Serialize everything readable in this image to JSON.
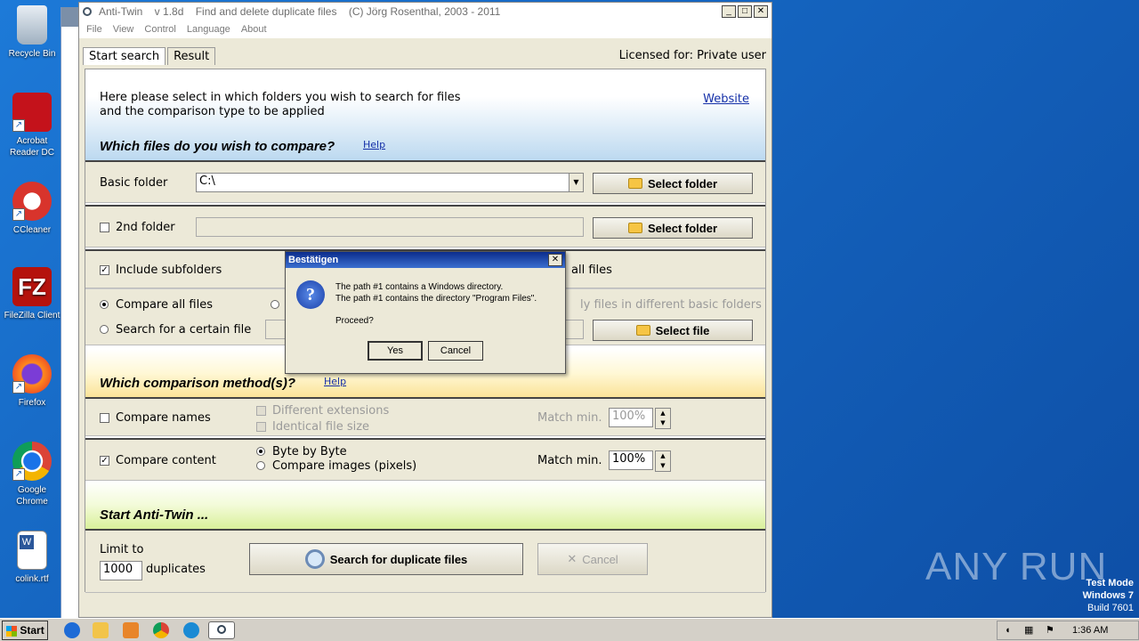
{
  "desktop": {
    "icons": [
      {
        "label": "Recycle Bin"
      },
      {
        "label": "Acrobat Reader DC"
      },
      {
        "label": "CCleaner"
      },
      {
        "label": "FileZilla Client"
      },
      {
        "label": "Firefox"
      },
      {
        "label": "Google Chrome"
      },
      {
        "label": "colink.rtf"
      }
    ],
    "watermark": "ANY RUN",
    "test_mode": {
      "line1": "Test Mode",
      "line2": "Windows 7",
      "line3": "Build 7601"
    }
  },
  "window": {
    "title": "Anti-Twin    v 1.8d    Find and delete duplicate files    (C) Jörg Rosenthal, 2003 - 2011",
    "menu": [
      "File",
      "View",
      "Control",
      "Language",
      "About"
    ],
    "tabs": [
      "Start search",
      "Result"
    ],
    "licensed": "Licensed for: Private user"
  },
  "intro": {
    "line1": "Here please select in which folders you wish to search for files",
    "line2": "and the comparison type to be applied",
    "website": "Website"
  },
  "files_section": {
    "title": "Which files do you wish to compare?",
    "help": "Help",
    "basic_folder_label": "Basic folder",
    "basic_folder_value": "C:\\",
    "select_folder": "Select folder",
    "second_folder_label": "2nd folder",
    "second_folder_checked": false,
    "include_subfolders": "Include subfolders",
    "include_subfolders_checked": true,
    "all_files_partial": "all files",
    "compare_all_files": "Compare all files",
    "different_basic_partial": "ly files in different basic folders",
    "search_certain_file": "Search for a certain file",
    "select_file": "Select file"
  },
  "method_section": {
    "title": "Which comparison method(s)?",
    "help": "Help",
    "compare_names": "Compare names",
    "compare_names_checked": false,
    "different_extensions": "Different extensions",
    "identical_file_size": "Identical file size",
    "match_min": "Match min.",
    "match_names_value": "100%",
    "compare_content": "Compare content",
    "compare_content_checked": true,
    "byte_by_byte": "Byte by Byte",
    "compare_images": "Compare images (pixels)",
    "match_content_value": "100%"
  },
  "start_section": {
    "title": "Start Anti-Twin ...",
    "limit_to": "Limit to",
    "limit_value": "1000",
    "duplicates": "duplicates",
    "search_button": "Search for duplicate files",
    "cancel_button": "Cancel"
  },
  "dialog": {
    "title": "Bestätigen",
    "line1": "The path #1 contains a Windows directory.",
    "line2": "The path #1 contains the directory \"Program Files\".",
    "line3": "Proceed?",
    "yes": "Yes",
    "cancel": "Cancel"
  },
  "taskbar": {
    "start": "Start",
    "clock": "1:36 AM"
  }
}
